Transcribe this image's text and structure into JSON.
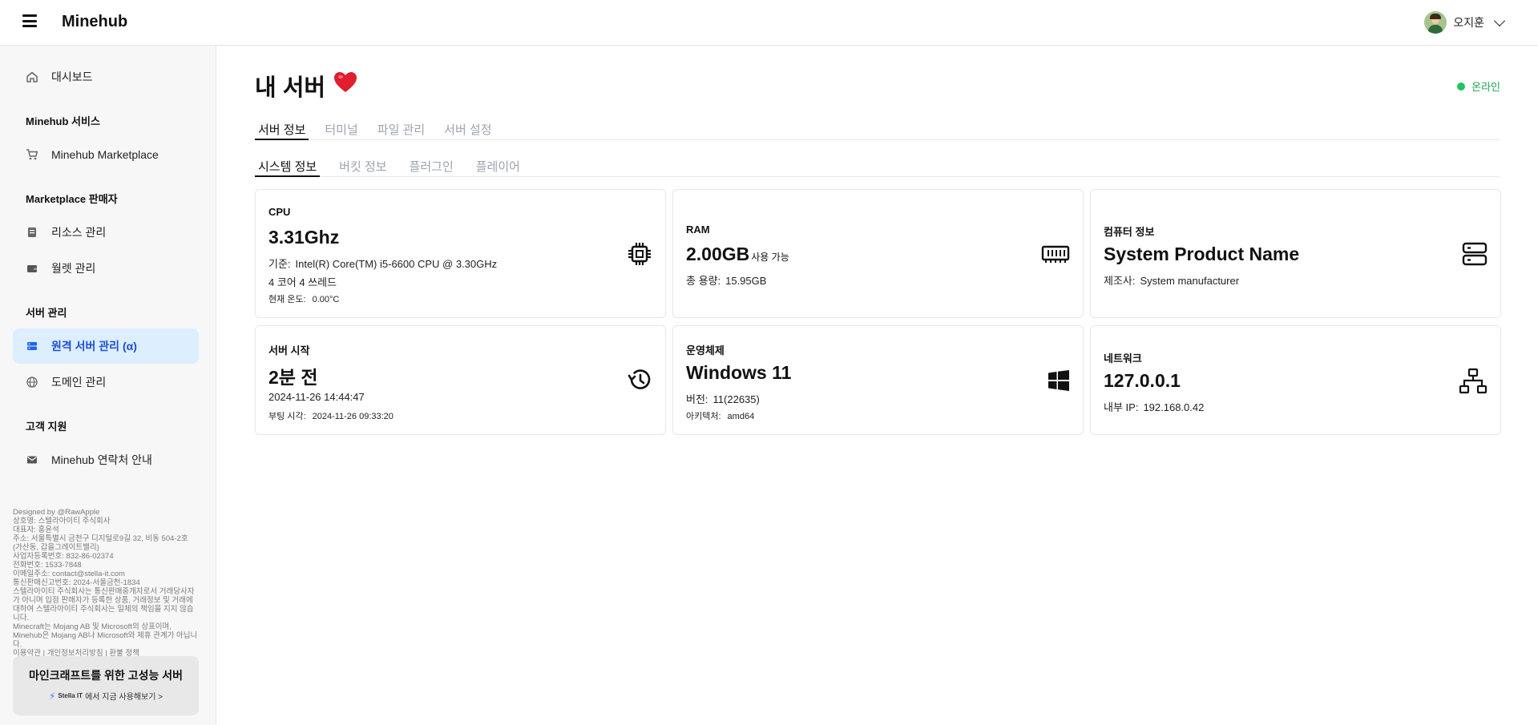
{
  "app": {
    "brand": "Minehub",
    "user_name": "오지훈"
  },
  "sidebar": {
    "dashboard": "대시보드",
    "sections": {
      "services": "Minehub 서비스",
      "seller": "Marketplace 판매자",
      "server": "서버 관리",
      "support": "고객 지원"
    },
    "items": {
      "marketplace": "Minehub Marketplace",
      "resources": "리소스 관리",
      "wallet": "월렛 관리",
      "remote_server": "원격 서버 관리 (α)",
      "domain": "도메인 관리",
      "contact": "Minehub 연락처 안내"
    },
    "footer": [
      "Designed by @RawApple",
      "상호명: 스텔라아이티 주식회사",
      "대표자: 홍윤석",
      "주소: 서울특별시 금천구 디지털로9길 32, 비동 504-2호 (가산동, 갑을그레이트밸리)",
      "사업자등록번호: 832-86-02374",
      "전화번호: 1533-7848",
      "이메일주소: contact@stella-it.com",
      "통신판매신고번호: 2024-서울금천-1834",
      "스텔라아이티 주식회사는 통신판매중개자로서 거래당사자가 아니며 입점 판매자가 등록한 상품, 거래정보 및 거래에 대하여 스텔라아이티 주식회사는 일체의 책임을 지지 않습니다.",
      "Minecraft는 Mojang AB 및 Microsoft의 상표이며, Minehub은 Mojang AB나 Microsoft와 제휴 관계가 아닙니다.",
      "이용약관 | 개인정보처리방침 | 환불 정책"
    ],
    "promo": {
      "title": "마인크래프트를 위한 고성능 서버",
      "brand": "Stella IT",
      "cta": "에서 지금 사용해보기 >"
    }
  },
  "main": {
    "title": "내 서버",
    "status": "온라인",
    "tabs": [
      "서버 정보",
      "터미널",
      "파일 관리",
      "서버 설정"
    ],
    "subtabs": [
      "시스템 정보",
      "버킷 정보",
      "플러그인",
      "플레이어"
    ]
  },
  "cards": {
    "cpu": {
      "title": "CPU",
      "value": "3.31Ghz",
      "base_key": "기준:",
      "base_val": "Intel(R) Core(TM) i5-6600 CPU @ 3.30GHz",
      "cores": "4 코어 4 쓰레드",
      "temp_key": "현재 온도:",
      "temp_val": "0.00°C"
    },
    "ram": {
      "title": "RAM",
      "value": "2.00GB",
      "value_suffix": "사용 가능",
      "total_key": "총 용량:",
      "total_val": "15.95GB"
    },
    "computer": {
      "title": "컴퓨터 정보",
      "value": "System Product Name",
      "maker_key": "제조사:",
      "maker_val": "System manufacturer"
    },
    "uptime": {
      "title": "서버 시작",
      "value": "2분 전",
      "start_time": "2024-11-26 14:44:47",
      "boot_key": "부팅 시각:",
      "boot_val": "2024-11-26 09:33:20"
    },
    "os": {
      "title": "운영체제",
      "value": "Windows 11",
      "version_key": "버전:",
      "version_val": "11(22635)",
      "arch_key": "아키텍처:",
      "arch_val": "amd64"
    },
    "network": {
      "title": "네트워크",
      "value": "127.0.0.1",
      "ip_key": "내부 IP:",
      "ip_val": "192.168.0.42"
    }
  }
}
